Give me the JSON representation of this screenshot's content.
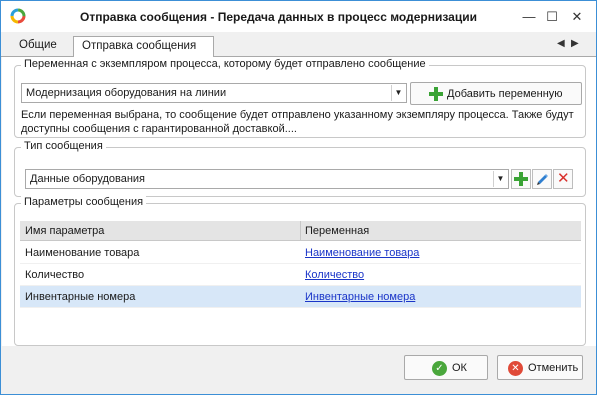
{
  "window": {
    "title": "Отправка сообщения - Передача данных в процесс модернизации",
    "controls": {
      "minimize": "—",
      "maximize": "☐",
      "close": "✕"
    }
  },
  "tabs": [
    {
      "label": "Общие",
      "active": false
    },
    {
      "label": "Отправка сообщения",
      "active": true
    }
  ],
  "tab_scroll": {
    "left": "◀",
    "right": "▶"
  },
  "instance_group": {
    "legend": "Переменная с экземпляром процесса, которому будет отправлено сообщение",
    "selected_value": "Модернизация оборудования на линии",
    "add_button_label": "Добавить переменную",
    "hint": "Если переменная выбрана, то сообщение будет отправлено указанному экземпляру процесса. Также будут доступны сообщения с гарантированной доставкой...."
  },
  "message_type_group": {
    "legend": "Тип сообщения",
    "selected_value": "Данные оборудования"
  },
  "params_group": {
    "legend": "Параметры сообщения",
    "columns": [
      "Имя параметра",
      "Переменная"
    ],
    "rows": [
      {
        "name": "Наименование товара",
        "variable": "Наименование товара",
        "selected": false
      },
      {
        "name": "Количество",
        "variable": "Количество",
        "selected": false
      },
      {
        "name": "Инвентарные номера",
        "variable": "Инвентарные номера",
        "selected": true
      }
    ]
  },
  "footer": {
    "ok_label": "ОК",
    "cancel_label": "Отменить"
  },
  "colors": {
    "window_border": "#3c8fd6",
    "link": "#1a35c8",
    "selected_row": "#d7e7f8",
    "add_green": "#3aa335",
    "delete_red": "#d9302c"
  },
  "icons": [
    "app-logo-icon",
    "plus-icon",
    "pencil-icon",
    "delete-x-icon",
    "ok-check-icon",
    "cancel-x-icon"
  ]
}
